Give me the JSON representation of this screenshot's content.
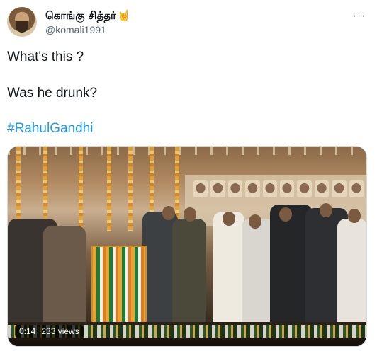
{
  "author": {
    "display_name": "கொங்கு சித்தர்",
    "name_emoji": "🤘",
    "handle": "@komali1991"
  },
  "tweet": {
    "line1": "What's this ?",
    "line2": "Was he drunk?",
    "hashtag": "#RahulGandhi"
  },
  "media": {
    "timestamp": "0:14",
    "views": "233 views"
  },
  "icons": {
    "more": "more-options-icon",
    "avatar": "profile-avatar"
  },
  "colors": {
    "link": "#1d9bf0",
    "text": "#0f1419",
    "secondary": "#536471"
  }
}
